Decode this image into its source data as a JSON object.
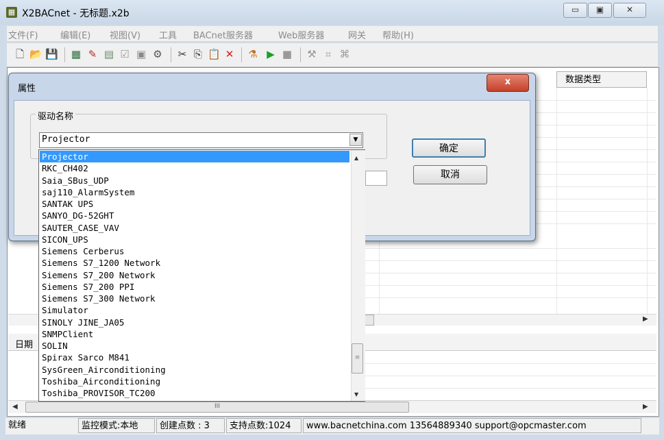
{
  "window": {
    "title": "X2BACnet - 无标题.x2b",
    "app_icon": "app-icon",
    "min_symbol": "▭",
    "max_symbol": "▣",
    "close_symbol": "✕"
  },
  "menu": [
    "文件(F)",
    "编辑(E)",
    "视图(V)",
    "工具",
    "BACnet服务器",
    "Web服务器",
    "网关",
    "帮助(H)"
  ],
  "toolbar": {
    "icons": [
      "new-file-icon",
      "open-folder-icon",
      "save-icon",
      "database-icon",
      "pin-icon",
      "table-icon",
      "properties-icon",
      "copy-device-icon",
      "settings-icon",
      "cut-icon",
      "copy-icon",
      "paste-icon",
      "delete-icon",
      "run-config-icon",
      "play-icon",
      "stop-icon",
      "tool-icon",
      "grid-icon",
      "gateway-icon"
    ],
    "glyphs": [
      "🗋",
      "📂",
      "💾",
      "▦",
      "✎",
      "▤",
      "☑",
      "▣",
      "⚙",
      "✂",
      "⎘",
      "📋",
      "✕",
      "⚗",
      "▶",
      "■",
      "⚒",
      "⌗",
      "⌘"
    ]
  },
  "main": {
    "column_header": "数据类型",
    "log_column": "日期"
  },
  "dialog": {
    "title": "属性",
    "close_label": "x",
    "group_label": "驱动名称",
    "combo_value": "Projector",
    "combo_arrow": "▼",
    "ok_label": "确定",
    "cancel_label": "取消",
    "options": [
      "Projector",
      "RKC_CH402",
      "Saia_SBus_UDP",
      "saj110_AlarmSystem",
      "SANTAK UPS",
      "SANYO_DG-52GHT",
      "SAUTER_CASE_VAV",
      "SICON_UPS",
      "Siemens Cerberus",
      "Siemens S7_1200 Network",
      "Siemens S7_200 Network",
      "Siemens S7_200 PPI",
      "Siemens S7_300 Network",
      "Simulator",
      "SINOLY JINE_JA05",
      "SNMPClient",
      "SOLIN",
      "Spirax Sarco M841",
      "SysGreen_Airconditioning",
      "Toshiba_Airconditioning",
      "Toshiba_PROVISOR_TC200"
    ],
    "selected_index": 0,
    "scroll_up": "▲",
    "scroll_down": "▼",
    "thumb_grip": "≡"
  },
  "scrollbars": {
    "left_arrow": "◀",
    "right_arrow": "▶",
    "grip": "III"
  },
  "status": {
    "ready": "就绪",
    "mode": "监控模式:本地",
    "created_points": "创建点数 : 3",
    "supported_points": "支持点数:1024",
    "contact": "www.bacnetchina.com 13564889340 support@opcmaster.com"
  },
  "colors": {
    "selection": "#3399ff",
    "dialog_frame": "#c7d6e8",
    "close_red": "#c5412a",
    "ok_border": "#3c7fb1"
  }
}
